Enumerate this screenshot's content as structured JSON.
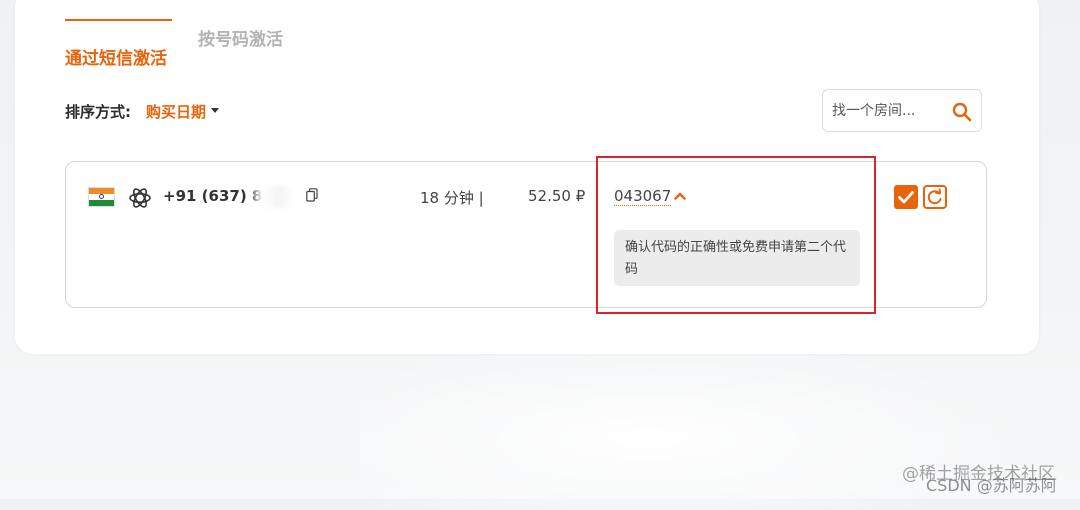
{
  "tabs": {
    "sms_label": "通过短信激活",
    "number_label": "按号码激活"
  },
  "sort": {
    "label": "排序方式:",
    "value": "购买日期"
  },
  "search": {
    "placeholder": "找一个房间..."
  },
  "order": {
    "country_flag": "india-flag",
    "service_icon": "openai-logo-icon",
    "phone": "+91 (637) 8",
    "time_left": "18 分钟 |",
    "price": "52.50 ₽",
    "code": "043067",
    "hint": "确认代码的正确性或免费申请第二个代码"
  },
  "colors": {
    "accent": "#e8640c",
    "highlight_border": "#d4262b",
    "hint_bg": "#ececec"
  },
  "watermark": {
    "line1": "@稀土掘金技术社区",
    "line2": "CSDN @苏阿苏阿"
  }
}
